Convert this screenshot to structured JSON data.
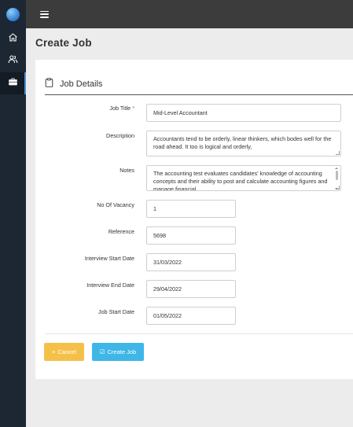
{
  "form": {
    "section_title": "Job Details",
    "job_title": {
      "label": "Job Title",
      "required_mark": "*",
      "value": "Mid-Level Accountant"
    },
    "description": {
      "label": "Description",
      "value": "Accountants tend to be orderly, linear thinkers, which bodes well for the road ahead. It too is logical and orderly,"
    },
    "notes": {
      "label": "Notes",
      "value": "The accounting test evaluates candidates' knowledge of accounting concepts and their ability to post and calculate accounting figures and manage financial"
    },
    "vacancy": {
      "label": "No Of Vacancy",
      "value": "1"
    },
    "reference": {
      "label": "Reference",
      "value": "5698"
    },
    "interview_start": {
      "label": "Interview Start Date",
      "value": "31/03/2022"
    },
    "interview_end": {
      "label": "Interview End Date",
      "value": "29/04/2022"
    },
    "job_start": {
      "label": "Job Start Date",
      "value": "01/05/2022"
    }
  },
  "actions": {
    "cancel_icon": "×",
    "cancel_label": "Cancel",
    "create_icon": "☑",
    "create_label": "Create Job"
  },
  "page": {
    "title": "Create Job"
  },
  "sidebar": {
    "items": [
      "home-icon",
      "users-icon",
      "briefcase-icon"
    ]
  },
  "colors": {
    "sidebar": "#1d2733",
    "topbar": "#3c3c3c",
    "cancel": "#f5c04a",
    "create": "#3fb6e8"
  }
}
